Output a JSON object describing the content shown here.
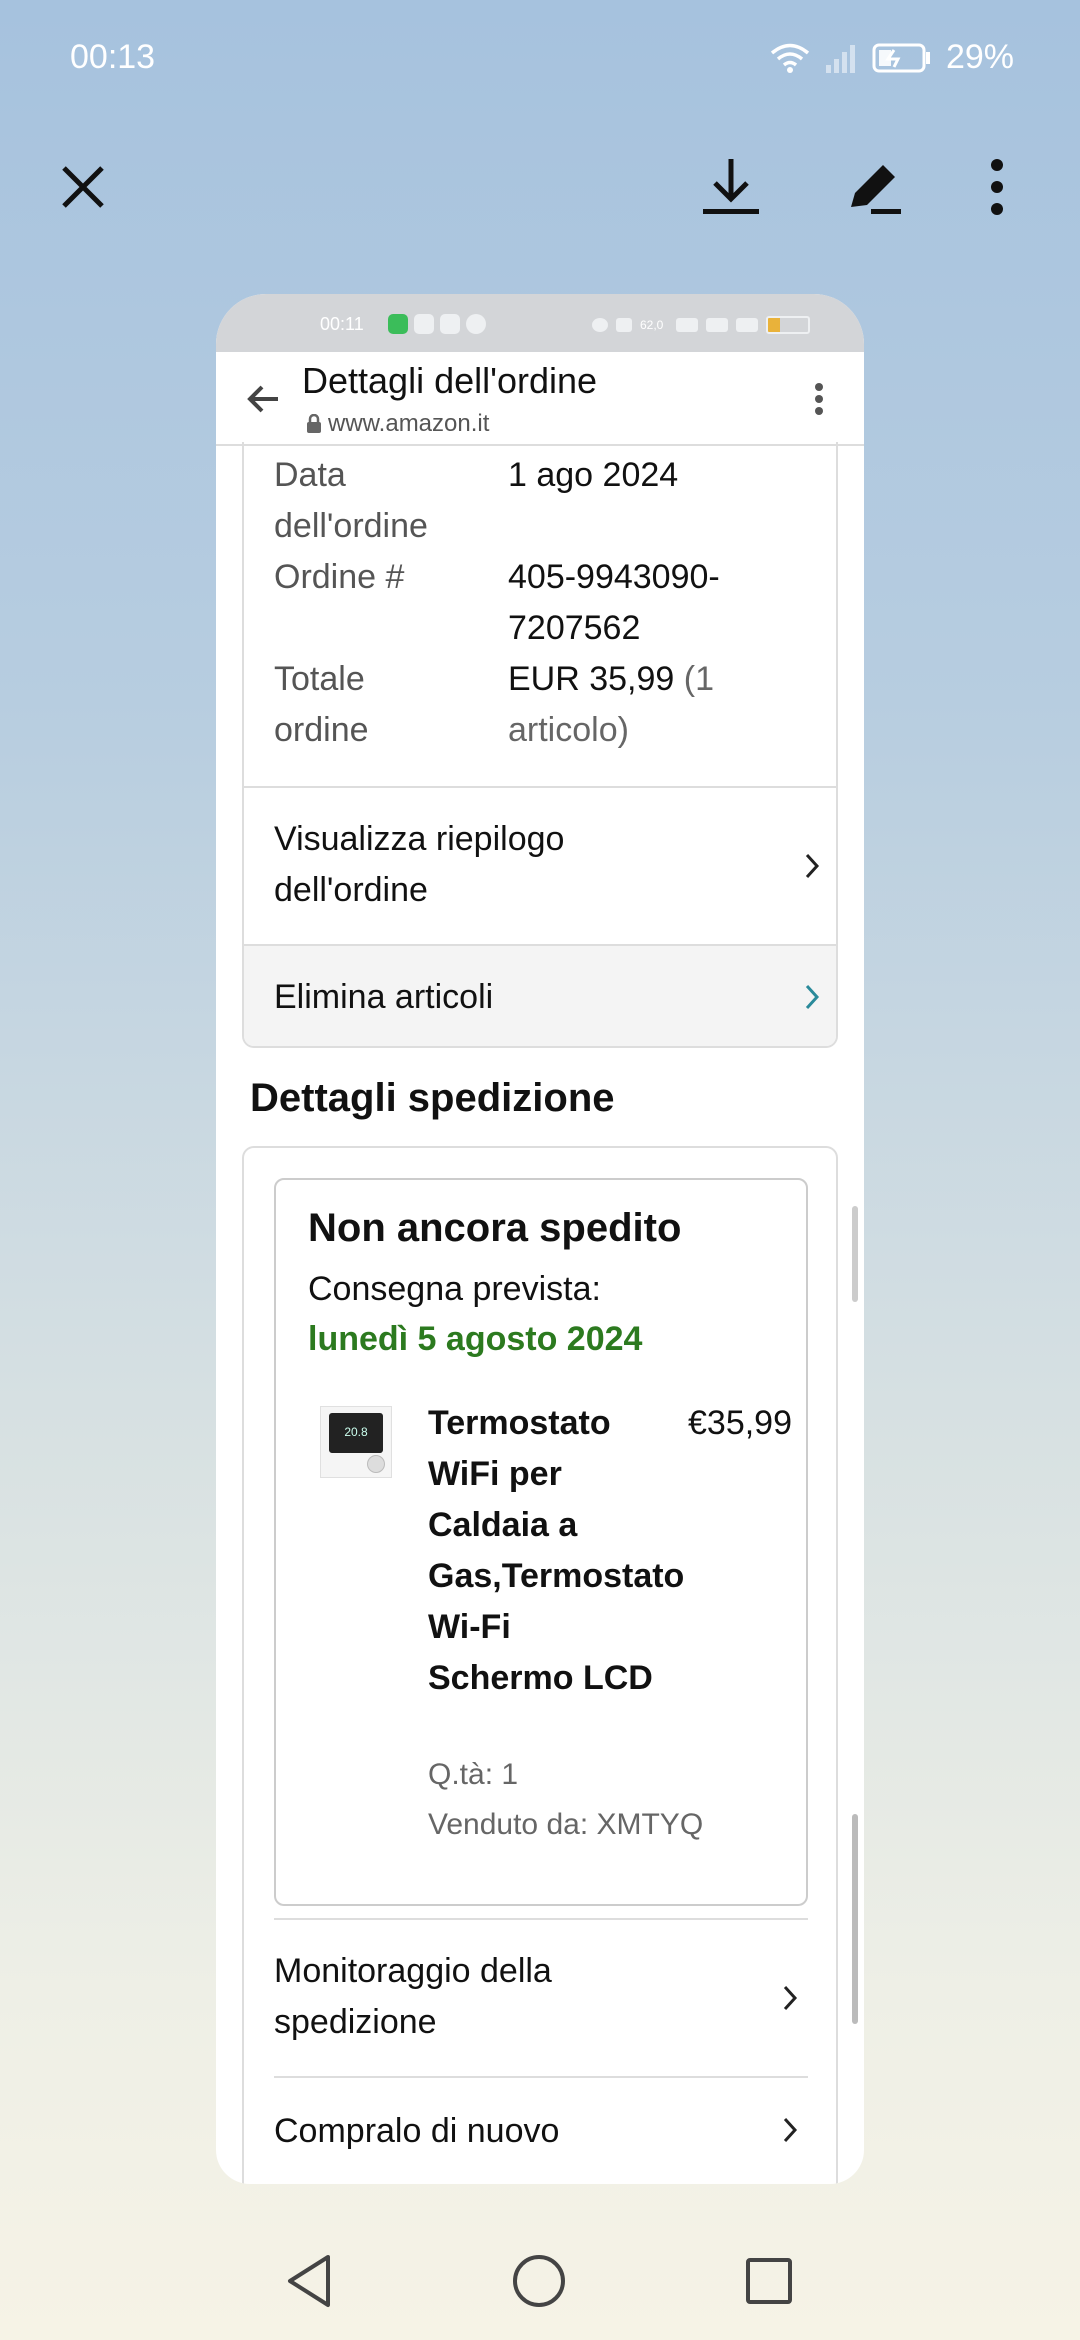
{
  "outer_status": {
    "time": "00:13",
    "battery": "29%"
  },
  "inner": {
    "status_time": "00:11",
    "speed_label": "62,0",
    "header": {
      "title": "Dettagli dell'ordine",
      "url": "www.amazon.it"
    },
    "order": {
      "date_label": "Data dell'ordine",
      "date_value": "1 ago 2024",
      "number_label": "Ordine #",
      "number_value": "405-9943090-7207562",
      "total_label": "Totale ordine",
      "total_value": "EUR 35,99",
      "total_note": "(1 articolo)"
    },
    "links": {
      "summary": "Visualizza riepilogo dell'ordine",
      "delete": "Elimina articoli"
    },
    "shipping": {
      "section_title": "Dettagli spedizione",
      "status": "Non ancora spedito",
      "eta_label": "Consegna prevista:",
      "eta_date": "lunedì 5 agosto 2024",
      "product": {
        "name": "Termostato WiFi per Caldaia a Gas,Termostato Wi-Fi Schermo LCD",
        "price": "€35,99",
        "qty": "Q.tà: 1",
        "seller": "Venduto da: XMTYQ",
        "thumb_text": "20.8"
      },
      "track": "Monitoraggio della spedizione",
      "buy_again": "Compralo di nuovo"
    }
  },
  "colors": {
    "eta_green": "#2c7a1f",
    "delete_chevron": "#2a8a9a"
  }
}
